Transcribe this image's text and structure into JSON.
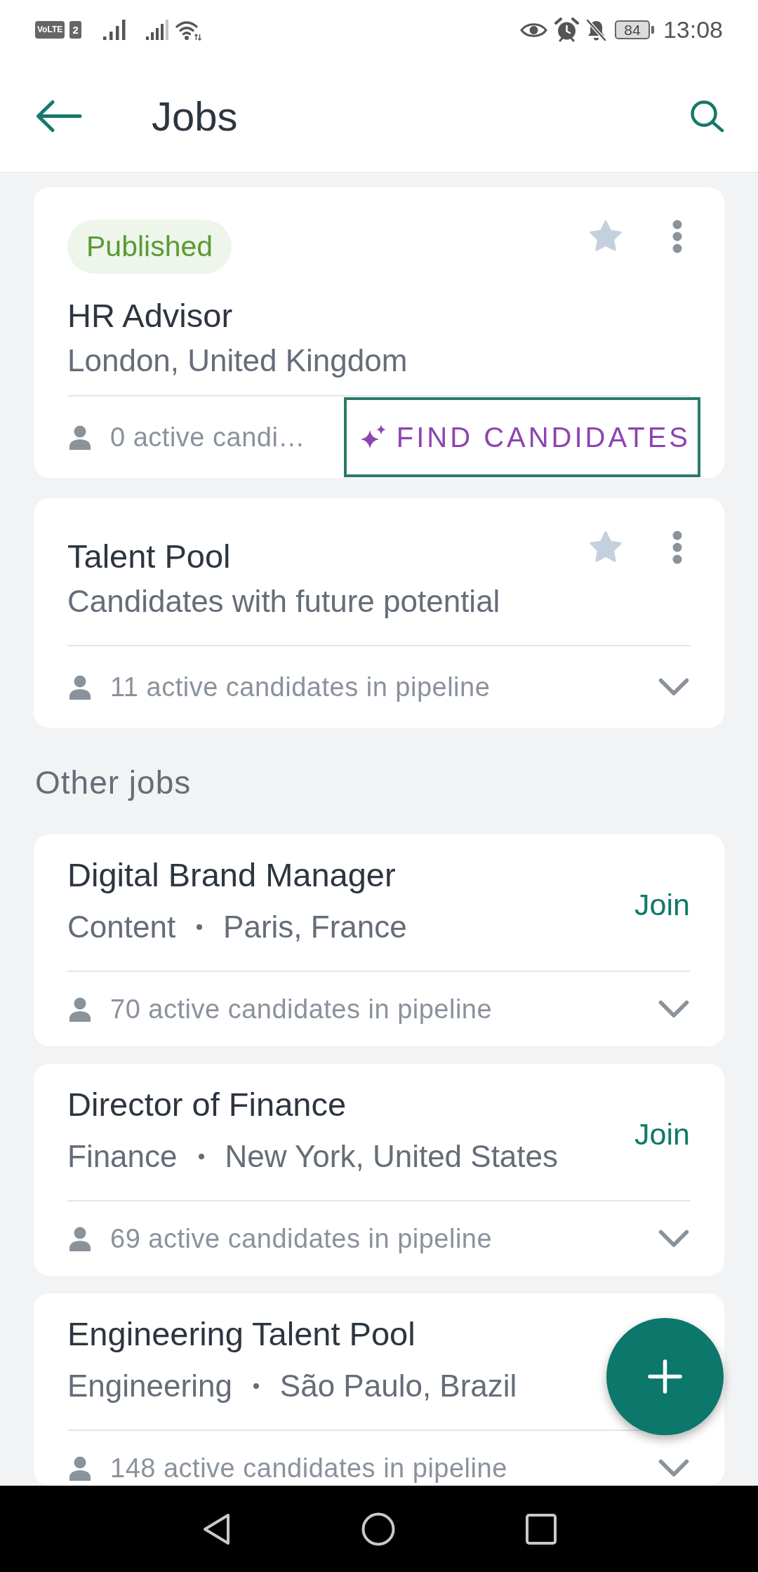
{
  "status_bar": {
    "network_badge": "VoLTE",
    "sim_badge": "2",
    "battery": "84",
    "time": "13:08"
  },
  "app_bar": {
    "title": "Jobs"
  },
  "my_jobs": [
    {
      "status": "Published",
      "title": "HR Advisor",
      "subtitle": "London, United Kingdom",
      "starred": false,
      "candidates": "0 active candi…",
      "action": {
        "label": "FIND CANDIDATES",
        "focused": true
      }
    },
    {
      "title": "Talent Pool",
      "subtitle": "Candidates with future potential",
      "starred": false,
      "candidates": "11 active candidates in pipeline",
      "expanded": false
    }
  ],
  "other_jobs": {
    "heading": "Other jobs",
    "items": [
      {
        "title": "Digital Brand Manager",
        "department": "Content",
        "location": "Paris, France",
        "join": "Join",
        "candidates": "70 active candidates in pipeline",
        "expanded": false
      },
      {
        "title": "Director of Finance",
        "department": "Finance",
        "location": "New York, United States",
        "join": "Join",
        "candidates": "69 active candidates in pipeline",
        "expanded": false
      },
      {
        "title": "Engineering Talent Pool",
        "department": "Engineering",
        "location": "São Paulo, Brazil",
        "candidates": "148 active candidates in pipeline",
        "expanded": false
      }
    ]
  }
}
